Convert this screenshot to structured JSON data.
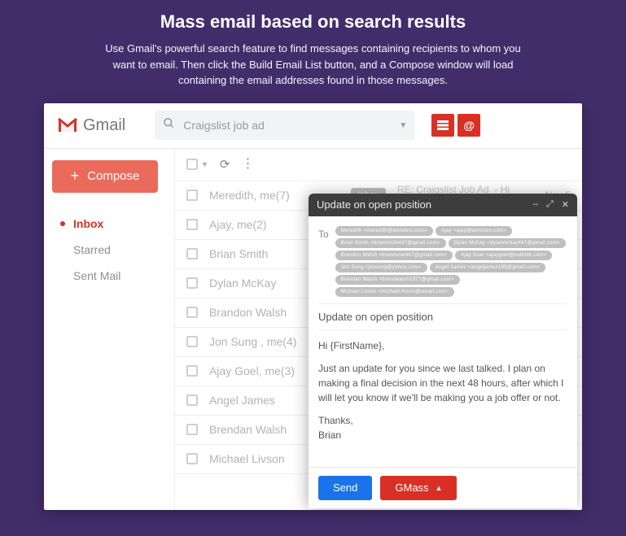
{
  "hero": {
    "title": "Mass email based on search results",
    "subtitle": "Use Gmail's powerful search feature to find messages containing recipients to whom you want to email. Then click the Build Email List button, and a Compose window will load containing the email addresses found in those messages."
  },
  "header": {
    "brand": "Gmail",
    "search_value": "Craigslist job ad"
  },
  "sidebar": {
    "compose_label": "Compose",
    "items": [
      {
        "label": "Inbox",
        "active": true
      },
      {
        "label": "Starred",
        "active": false
      },
      {
        "label": "Sent Mail",
        "active": false
      }
    ]
  },
  "inbox": {
    "pill": "Inbox",
    "rows": [
      {
        "sender": "Meredith, me(7)",
        "subject": "RE: Craigslist Job Ad",
        "snippet": "- Hi Meredith",
        "date": "Nov 5"
      },
      {
        "sender": "Ajay, me(2)"
      },
      {
        "sender": "Brian Smith"
      },
      {
        "sender": "Dylan McKay"
      },
      {
        "sender": "Brandon Walsh"
      },
      {
        "sender": "Jon Sung , me(4)"
      },
      {
        "sender": "Ajay Goel, me(3)"
      },
      {
        "sender": "Angel James"
      },
      {
        "sender": "Brendan Walsh"
      },
      {
        "sender": "Michael Livson"
      }
    ]
  },
  "compose": {
    "title": "Update on open position",
    "to_label": "To",
    "recipients": [
      "Meredith <meredith@wonders.com>",
      "Ajay <ajay@wordzen.com>",
      "Brian Smith <briansmith447@gmail.com>",
      "Dylan McKay <dylanmckay447@gmail.com>",
      "Brandon Walsh <brandonw447@gmail.com>",
      "Ajay Goel <ajaygoel@outlook.com>",
      "Jon Sung <jonsung@yahoo.com>",
      "Angel James <angeljames199@gmail.com>",
      "Brendan Walsh <brendwalsh1977@gmail.com>",
      "Michael Livson <michael.livson@wmail.com>"
    ],
    "subject": "Update on open position",
    "greeting": "Hi {FirstName},",
    "body": "Just an update for you since we last talked. I plan on making a final decision in the next 48 hours, after which I will let you know if we'll be making you a job offer or not.",
    "signoff1": "Thanks,",
    "signoff2": "Brian",
    "send_label": "Send",
    "gmass_label": "GMass"
  }
}
